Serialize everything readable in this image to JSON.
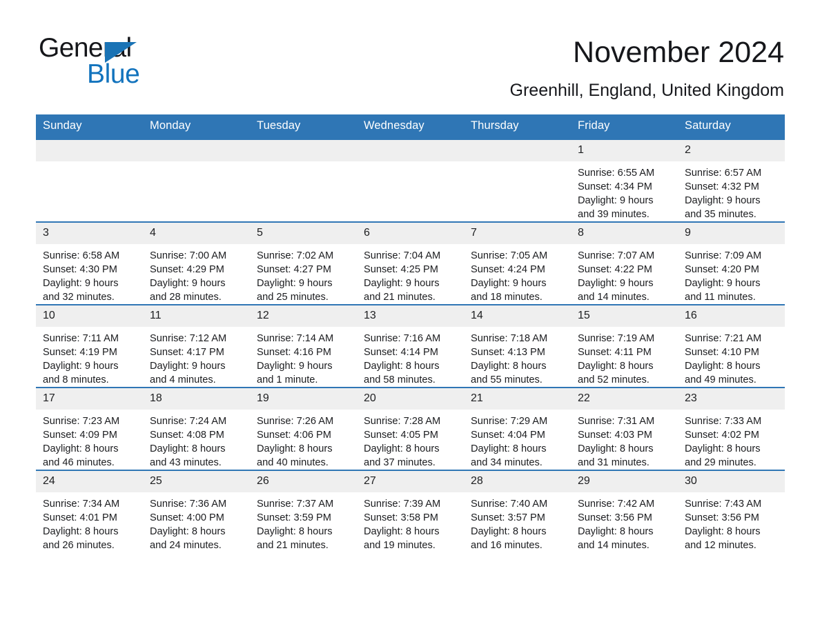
{
  "brand": {
    "name_part1": "General",
    "name_part2": "Blue",
    "logo_icon": "triangle-flag-icon",
    "accent_color": "#1273bd"
  },
  "header": {
    "month_title": "November 2024",
    "location": "Greenhill, England, United Kingdom"
  },
  "calendar": {
    "header_color": "#2f76b5",
    "daynum_band_color": "#efefef",
    "weekdays": [
      "Sunday",
      "Monday",
      "Tuesday",
      "Wednesday",
      "Thursday",
      "Friday",
      "Saturday"
    ],
    "weeks": [
      [
        {
          "day": "",
          "lines": []
        },
        {
          "day": "",
          "lines": []
        },
        {
          "day": "",
          "lines": []
        },
        {
          "day": "",
          "lines": []
        },
        {
          "day": "",
          "lines": []
        },
        {
          "day": "1",
          "lines": [
            "Sunrise: 6:55 AM",
            "Sunset: 4:34 PM",
            "Daylight: 9 hours",
            "and 39 minutes."
          ]
        },
        {
          "day": "2",
          "lines": [
            "Sunrise: 6:57 AM",
            "Sunset: 4:32 PM",
            "Daylight: 9 hours",
            "and 35 minutes."
          ]
        }
      ],
      [
        {
          "day": "3",
          "lines": [
            "Sunrise: 6:58 AM",
            "Sunset: 4:30 PM",
            "Daylight: 9 hours",
            "and 32 minutes."
          ]
        },
        {
          "day": "4",
          "lines": [
            "Sunrise: 7:00 AM",
            "Sunset: 4:29 PM",
            "Daylight: 9 hours",
            "and 28 minutes."
          ]
        },
        {
          "day": "5",
          "lines": [
            "Sunrise: 7:02 AM",
            "Sunset: 4:27 PM",
            "Daylight: 9 hours",
            "and 25 minutes."
          ]
        },
        {
          "day": "6",
          "lines": [
            "Sunrise: 7:04 AM",
            "Sunset: 4:25 PM",
            "Daylight: 9 hours",
            "and 21 minutes."
          ]
        },
        {
          "day": "7",
          "lines": [
            "Sunrise: 7:05 AM",
            "Sunset: 4:24 PM",
            "Daylight: 9 hours",
            "and 18 minutes."
          ]
        },
        {
          "day": "8",
          "lines": [
            "Sunrise: 7:07 AM",
            "Sunset: 4:22 PM",
            "Daylight: 9 hours",
            "and 14 minutes."
          ]
        },
        {
          "day": "9",
          "lines": [
            "Sunrise: 7:09 AM",
            "Sunset: 4:20 PM",
            "Daylight: 9 hours",
            "and 11 minutes."
          ]
        }
      ],
      [
        {
          "day": "10",
          "lines": [
            "Sunrise: 7:11 AM",
            "Sunset: 4:19 PM",
            "Daylight: 9 hours",
            "and 8 minutes."
          ]
        },
        {
          "day": "11",
          "lines": [
            "Sunrise: 7:12 AM",
            "Sunset: 4:17 PM",
            "Daylight: 9 hours",
            "and 4 minutes."
          ]
        },
        {
          "day": "12",
          "lines": [
            "Sunrise: 7:14 AM",
            "Sunset: 4:16 PM",
            "Daylight: 9 hours",
            "and 1 minute."
          ]
        },
        {
          "day": "13",
          "lines": [
            "Sunrise: 7:16 AM",
            "Sunset: 4:14 PM",
            "Daylight: 8 hours",
            "and 58 minutes."
          ]
        },
        {
          "day": "14",
          "lines": [
            "Sunrise: 7:18 AM",
            "Sunset: 4:13 PM",
            "Daylight: 8 hours",
            "and 55 minutes."
          ]
        },
        {
          "day": "15",
          "lines": [
            "Sunrise: 7:19 AM",
            "Sunset: 4:11 PM",
            "Daylight: 8 hours",
            "and 52 minutes."
          ]
        },
        {
          "day": "16",
          "lines": [
            "Sunrise: 7:21 AM",
            "Sunset: 4:10 PM",
            "Daylight: 8 hours",
            "and 49 minutes."
          ]
        }
      ],
      [
        {
          "day": "17",
          "lines": [
            "Sunrise: 7:23 AM",
            "Sunset: 4:09 PM",
            "Daylight: 8 hours",
            "and 46 minutes."
          ]
        },
        {
          "day": "18",
          "lines": [
            "Sunrise: 7:24 AM",
            "Sunset: 4:08 PM",
            "Daylight: 8 hours",
            "and 43 minutes."
          ]
        },
        {
          "day": "19",
          "lines": [
            "Sunrise: 7:26 AM",
            "Sunset: 4:06 PM",
            "Daylight: 8 hours",
            "and 40 minutes."
          ]
        },
        {
          "day": "20",
          "lines": [
            "Sunrise: 7:28 AM",
            "Sunset: 4:05 PM",
            "Daylight: 8 hours",
            "and 37 minutes."
          ]
        },
        {
          "day": "21",
          "lines": [
            "Sunrise: 7:29 AM",
            "Sunset: 4:04 PM",
            "Daylight: 8 hours",
            "and 34 minutes."
          ]
        },
        {
          "day": "22",
          "lines": [
            "Sunrise: 7:31 AM",
            "Sunset: 4:03 PM",
            "Daylight: 8 hours",
            "and 31 minutes."
          ]
        },
        {
          "day": "23",
          "lines": [
            "Sunrise: 7:33 AM",
            "Sunset: 4:02 PM",
            "Daylight: 8 hours",
            "and 29 minutes."
          ]
        }
      ],
      [
        {
          "day": "24",
          "lines": [
            "Sunrise: 7:34 AM",
            "Sunset: 4:01 PM",
            "Daylight: 8 hours",
            "and 26 minutes."
          ]
        },
        {
          "day": "25",
          "lines": [
            "Sunrise: 7:36 AM",
            "Sunset: 4:00 PM",
            "Daylight: 8 hours",
            "and 24 minutes."
          ]
        },
        {
          "day": "26",
          "lines": [
            "Sunrise: 7:37 AM",
            "Sunset: 3:59 PM",
            "Daylight: 8 hours",
            "and 21 minutes."
          ]
        },
        {
          "day": "27",
          "lines": [
            "Sunrise: 7:39 AM",
            "Sunset: 3:58 PM",
            "Daylight: 8 hours",
            "and 19 minutes."
          ]
        },
        {
          "day": "28",
          "lines": [
            "Sunrise: 7:40 AM",
            "Sunset: 3:57 PM",
            "Daylight: 8 hours",
            "and 16 minutes."
          ]
        },
        {
          "day": "29",
          "lines": [
            "Sunrise: 7:42 AM",
            "Sunset: 3:56 PM",
            "Daylight: 8 hours",
            "and 14 minutes."
          ]
        },
        {
          "day": "30",
          "lines": [
            "Sunrise: 7:43 AM",
            "Sunset: 3:56 PM",
            "Daylight: 8 hours",
            "and 12 minutes."
          ]
        }
      ]
    ]
  }
}
